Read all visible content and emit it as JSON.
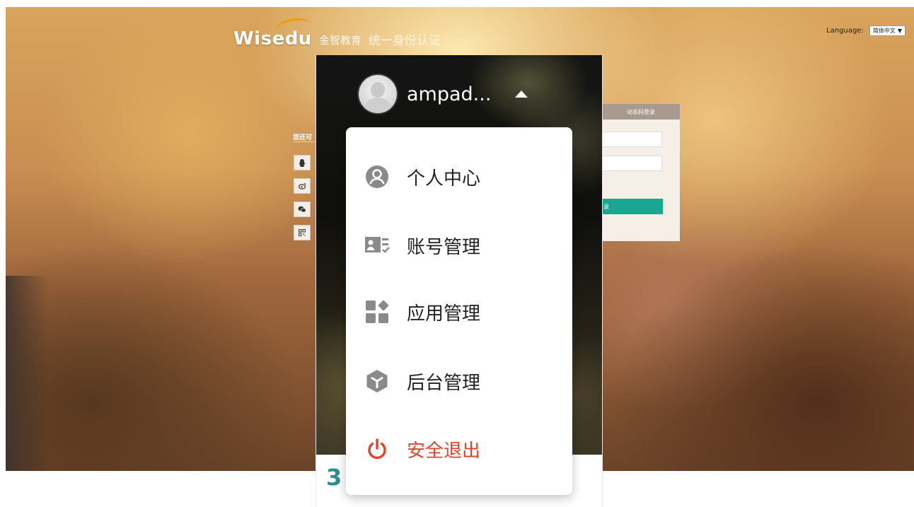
{
  "brand": {
    "logo_text": "Wisedu",
    "company_cn": "金智教育",
    "system_title": "统一身份认证"
  },
  "language": {
    "label": "Language:",
    "selected": "简体中文",
    "arrow": "▼"
  },
  "login_bg": {
    "side_text": "您还可",
    "dynamic_tab": "动态码登录",
    "login_button": "录"
  },
  "popup": {
    "username": "ampad...",
    "footer_number": "3"
  },
  "menu": {
    "items": [
      {
        "label": "个人中心",
        "icon": "user-circle-icon"
      },
      {
        "label": "账号管理",
        "icon": "id-card-icon"
      },
      {
        "label": "应用管理",
        "icon": "apps-grid-icon"
      },
      {
        "label": "后台管理",
        "icon": "cube-icon"
      },
      {
        "label": "安全退出",
        "icon": "power-icon"
      }
    ]
  },
  "colors": {
    "danger": "#e0452c",
    "icon_gray": "#8a8a8a",
    "teal": "#1aa68f"
  }
}
